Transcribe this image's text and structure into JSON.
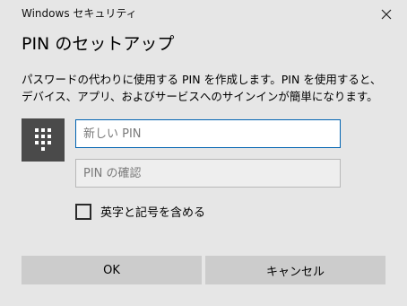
{
  "window": {
    "title": "Windows セキュリティ",
    "close_icon": "close-icon"
  },
  "dialog": {
    "heading": "PIN のセットアップ",
    "description": "パスワードの代わりに使用する PIN を作成します。PIN を使用すると、デバイス、アプリ、およびサービスへのサインインが簡単になります。",
    "keypad_icon": "keypad-icon",
    "new_pin": {
      "value": "",
      "placeholder": "新しい PIN"
    },
    "confirm_pin": {
      "value": "",
      "placeholder": "PIN の確認"
    },
    "include_letters": {
      "label": "英字と記号を含める",
      "checked": false
    },
    "buttons": {
      "ok": "OK",
      "cancel": "キャンセル"
    }
  },
  "colors": {
    "background": "#e6e6e6",
    "accent_focus_border": "#0063b1",
    "keypad_tile": "#4a4a4a",
    "button": "#cccccc"
  }
}
